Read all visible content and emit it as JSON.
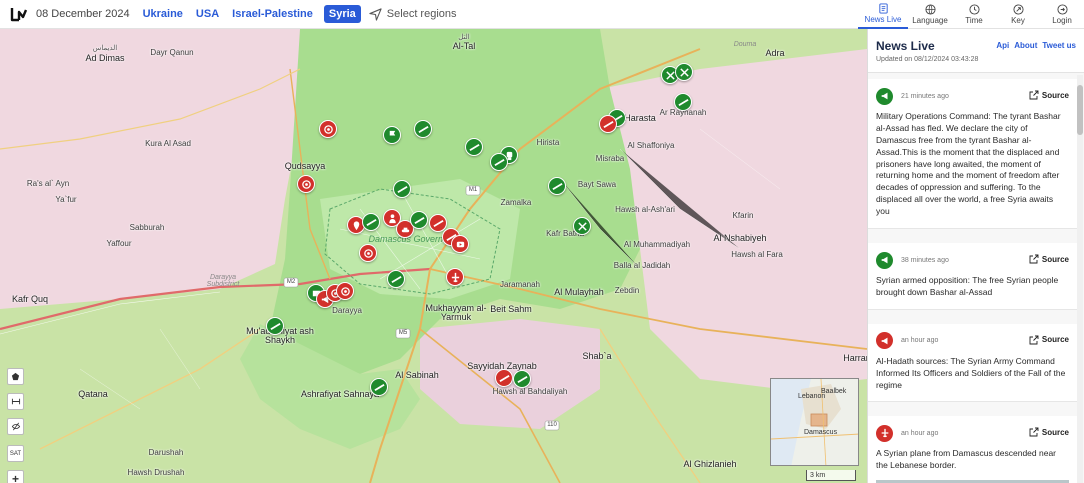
{
  "header": {
    "date": "08 December 2024",
    "regions": [
      {
        "label": "Ukraine",
        "active": false
      },
      {
        "label": "USA",
        "active": false
      },
      {
        "label": "Israel-Palestine",
        "active": false
      },
      {
        "label": "Syria",
        "active": true
      }
    ],
    "select_regions": "Select regions",
    "nav": [
      {
        "label": "News Live",
        "icon": "news-icon",
        "active": true
      },
      {
        "label": "Language",
        "icon": "language-icon",
        "active": false
      },
      {
        "label": "Time",
        "icon": "clock-icon",
        "active": false
      },
      {
        "label": "Key",
        "icon": "key-icon",
        "active": false
      },
      {
        "label": "Login",
        "icon": "login-icon",
        "active": false
      }
    ]
  },
  "map": {
    "labels": {
      "ad_dimas": "Ad Dimas",
      "ad_dimas_ar": "الديماس",
      "al_tal": "Al-Tal",
      "al_tal_ar": "التل",
      "harasta": "Harasta",
      "hirista": "Hirista",
      "qudsayya": "Qudsayya",
      "kafr_quq": "Kafr Quq",
      "dayr_qanun": "Dayr Qanun",
      "ras_al_ayn": "Ra's al` Ayn",
      "yafur": "Ya`fur",
      "yaffour": "Yaffour",
      "sabburah": "Sabburah",
      "kura_al_asad": "Kura Al Asad",
      "damascus_gov": "Damascus Governorate",
      "zamalka": "Zamalka",
      "kafr_batna": "Kafr Batna",
      "jaramanah": "Jaramanah",
      "al_mulayhah": "Al Mulayhah",
      "mukhayyam": "Mukhayyam al-Yarmuk",
      "beit_sahm": "Beit Sahm",
      "muadamiyat": "Mu'adamiyat ash Shaykh",
      "darayya": "Darayya",
      "darayya_sub": "Darayya Subdistrict",
      "al_sabinah": "Al Sabinah",
      "sayyidah": "Sayyidah Zaynab",
      "hawsh_bahdaliyah": "Hawsh al Bahdaliyah",
      "ashrafiyat": "Ashrafiyat Sahnaya",
      "qatana": "Qatana",
      "darushah": "Darushah",
      "hawsh_drushah": "Hawsh Drushah",
      "shaba": "Shab`a",
      "adra": "Adra",
      "douma": "Douma",
      "nashabiyeh": "Al Nshabiyeh",
      "harran": "Harran",
      "al_ghizlanieh": "Al Ghizlanieh",
      "ar_rayhanah": "Ar Rayhanah",
      "al_shaffoniya": "Al Shaffoniya",
      "misraba": "Misraba",
      "bayt_sawa": "Bayt Sawa",
      "hawsh_al_ashari": "Hawsh al-Ash'ari",
      "al_muhammadiyah": "Al Muhammadiyah",
      "balla": "Balla al Jadidah",
      "zebdin": "Zebdin",
      "hawsh_al_fara": "Hawsh al Fara",
      "kfarin": "Kfarin",
      "m5": "M5",
      "m1": "M1",
      "m2": "M2",
      "r110": "110"
    },
    "inset": {
      "lebanon": "Lebanon",
      "damascus": "Damascus",
      "baalbek": "Baalbek"
    },
    "scale": "3 km",
    "tools": [
      "SAT",
      "+"
    ]
  },
  "sidebar": {
    "title": "News Live",
    "links": [
      "Api",
      "About",
      "Tweet us"
    ],
    "updated": "Updated on 08/12/2024 03:43:28",
    "source_label": "Source",
    "items": [
      {
        "time": "21 minutes ago",
        "icon": "megaphone-icon",
        "color": "#1f8a2d",
        "text": "Military Operations Command: The tyrant Bashar al-Assad has fled. We declare the city of Damascus free from the tyrant Bashar al-Assad.This is the moment that the displaced and prisoners have long awaited, the moment of returning home and the moment of freedom after decades of oppression and suffering. To the displaced all over the world, a free Syria awaits you"
      },
      {
        "time": "38 minutes ago",
        "icon": "megaphone-icon",
        "color": "#1f8a2d",
        "text": "Syrian armed opposition: The free Syrian people brought down Bashar al-Assad"
      },
      {
        "time": "an hour ago",
        "icon": "megaphone-icon",
        "color": "#d2302b",
        "text": "Al-Hadath sources: The Syrian Army Command Informed Its Officers and Soldiers of the Fall of the regime"
      },
      {
        "time": "an hour ago",
        "icon": "plane-icon",
        "color": "#d2302b",
        "text": "A Syrian plane from Damascus descended near the Lebanese border."
      }
    ]
  }
}
